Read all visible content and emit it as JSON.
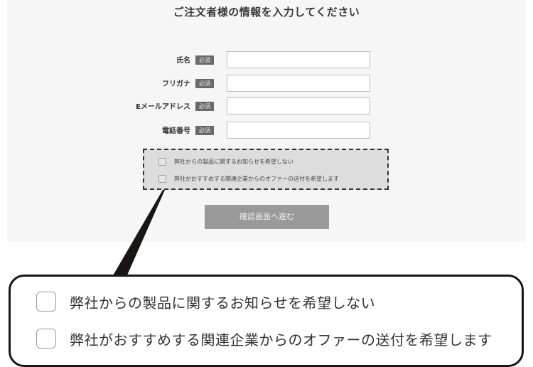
{
  "form": {
    "title": "ご注文者様の情報を入力してください",
    "required_badge": "必須",
    "fields": [
      {
        "label": "氏名",
        "value": ""
      },
      {
        "label": "フリガナ",
        "value": ""
      },
      {
        "label": "Eメールアドレス",
        "value": ""
      },
      {
        "label": "電話番号",
        "value": ""
      }
    ],
    "options": [
      {
        "label": "弊社からの製品に関するお知らせを希望しない",
        "checked": false
      },
      {
        "label": "弊社がおすすめする関連企業からのオファーの送付を希望します",
        "checked": false
      }
    ],
    "submit_label": "確認画面へ進む"
  },
  "callout": {
    "options": [
      {
        "label": "弊社からの製品に関するお知らせを希望しない",
        "checked": false
      },
      {
        "label": "弊社がおすすめする関連企業からのオファーの送付を希望します",
        "checked": false
      }
    ]
  },
  "colors": {
    "panel_bg": "#f6f6f6",
    "required_badge_bg": "#6a6a6a",
    "options_box_bg": "#dddddd",
    "submit_bg": "#9a9a9a",
    "callout_border": "#1b1414"
  }
}
